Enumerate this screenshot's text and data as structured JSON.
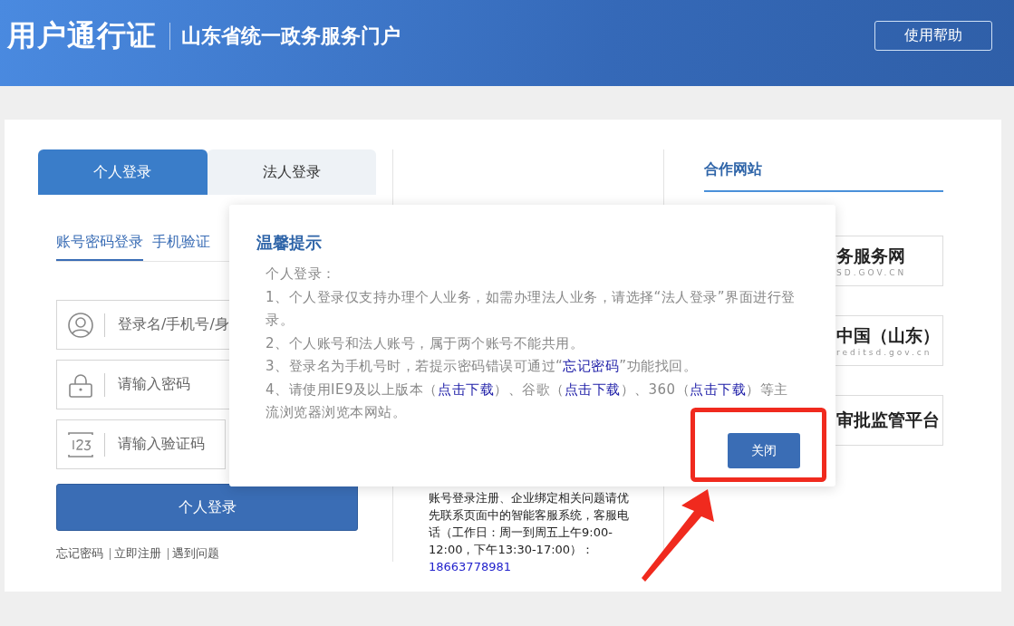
{
  "header": {
    "title": "用户通行证",
    "subtitle": "山东省统一政务服务门户",
    "help_button": "使用帮助"
  },
  "login": {
    "tabs": [
      {
        "label": "个人登录",
        "selected": true
      },
      {
        "label": "法人登录",
        "selected": false
      }
    ],
    "methods": [
      {
        "label": "账号密码登录",
        "selected": true
      },
      {
        "label": "手机验证",
        "selected": false
      }
    ],
    "fields": [
      {
        "kind": "user",
        "placeholder": "登录名/手机号/身"
      },
      {
        "kind": "lock",
        "placeholder": "请输入密码"
      },
      {
        "kind": "captcha",
        "placeholder": "请输入验证码"
      }
    ],
    "submit": "个人登录",
    "links": [
      "忘记密码",
      "立即注册",
      "遇到问题"
    ]
  },
  "help": {
    "text": "账号登录注册、企业绑定相关问题请优先联系页面中的智能客服系统，客服电话（工作日：周一到周五上午9:00-12:00，下午13:30-17:00）：",
    "phone": "18663778981"
  },
  "partners": {
    "title": "合作网站",
    "items": [
      {
        "name": "务服务网",
        "url": "SD.GOV.CN"
      },
      {
        "name": "中国（山东）",
        "url": "reditsd.gov.cn"
      },
      {
        "name": "审批监管平台"
      }
    ]
  },
  "dialog": {
    "title": "温馨提示",
    "paragraphs": [
      [
        {
          "text": "个人登录："
        }
      ],
      [
        {
          "text": "1、个人登录仅支持办理个人业务，如需办理法人业务，请选择“法人登录”界面进行登录。"
        }
      ],
      [
        {
          "text": "2、个人账号和法人账号，属于两个账号不能共用。"
        }
      ],
      [
        {
          "text": "3、登录名为手机号时，若提示密码错误可通过“"
        },
        {
          "text": "忘记密码",
          "link": true
        },
        {
          "text": "”功能找回。"
        }
      ],
      [
        {
          "text": "4、请使用IE9及以上版本（"
        },
        {
          "text": "点击下载",
          "link": true
        },
        {
          "text": "）、谷歌（"
        },
        {
          "text": "点击下载",
          "link": true
        },
        {
          "text": "）、360（"
        },
        {
          "text": "点击下载",
          "link": true
        },
        {
          "text": "）等主流浏览器浏览本网站。"
        }
      ]
    ],
    "close_button": "关闭"
  }
}
